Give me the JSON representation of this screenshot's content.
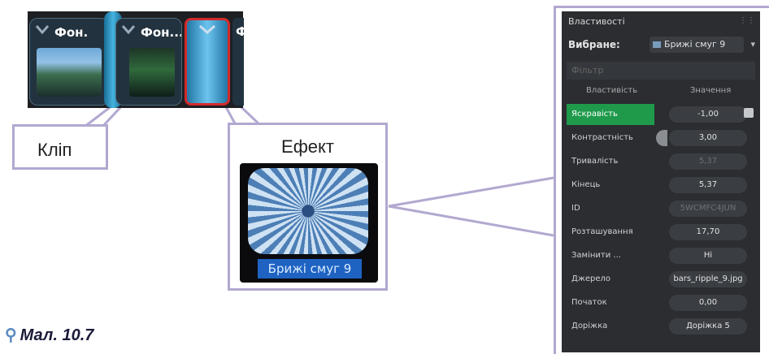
{
  "timeline": {
    "clips": [
      {
        "title": "Фон."
      },
      {
        "title": "Фон..."
      },
      {
        "title": "Ф"
      }
    ]
  },
  "callouts": {
    "clip_label": "Кліп",
    "effect_label": "Ефект",
    "effect_name": "Брижі смуг 9"
  },
  "caption": "Мал. 10.7",
  "panel": {
    "title": "Властивості",
    "selected_label": "Вибране:",
    "selected_value": "Брижі смуг 9",
    "filter_placeholder": "Фільтр",
    "col_property": "Властивість",
    "col_value": "Значення",
    "rows": [
      {
        "key": "Яскравість",
        "value": "-1,00"
      },
      {
        "key": "Контрастність",
        "value": "3,00"
      },
      {
        "key": "Тривалість",
        "value": "5,37"
      },
      {
        "key": "Кінець",
        "value": "5,37"
      },
      {
        "key": "ID",
        "value": "5WCMFC4JUN"
      },
      {
        "key": "Розташування",
        "value": "17,70"
      },
      {
        "key": "Замінити ...",
        "value": "Ні"
      },
      {
        "key": "Джерело",
        "value": "bars_ripple_9.jpg"
      },
      {
        "key": "Початок",
        "value": "0,00"
      },
      {
        "key": "Доріжка",
        "value": "Доріжка 5"
      }
    ]
  },
  "colors": {
    "accent_line": "#b2a8d0",
    "highlight_row": "#1f9a4b",
    "effect_border": "#d42a2a"
  }
}
